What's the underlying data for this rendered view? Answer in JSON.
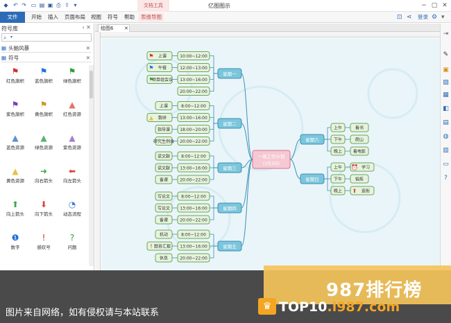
{
  "app": {
    "title": "亿图图示",
    "context_tab": "文档工具"
  },
  "menu": {
    "file": "文件",
    "items": [
      "开始",
      "插入",
      "页面布局",
      "视图",
      "符号",
      "帮助",
      "思维导图"
    ],
    "login": "登录"
  },
  "sidebar": {
    "title": "符号库",
    "sections": [
      "头脑风暴",
      "符号"
    ],
    "symbols": [
      {
        "label": "红色旗帜",
        "glyph": "⚑",
        "color": "#d32f2f"
      },
      {
        "label": "蓝色旗帜",
        "glyph": "⚑",
        "color": "#1e6fd9"
      },
      {
        "label": "绿色旗帜",
        "glyph": "⚑",
        "color": "#2e9e3a"
      },
      {
        "label": "紫色旗帜",
        "glyph": "⚑",
        "color": "#7b3fb5"
      },
      {
        "label": "黄色旗帜",
        "glyph": "⚑",
        "color": "#c99a1e"
      },
      {
        "label": "红色资源",
        "glyph": "▲",
        "color": "#e5736b"
      },
      {
        "label": "蓝色资源",
        "glyph": "▲",
        "color": "#5b8fd6"
      },
      {
        "label": "绿色资源",
        "glyph": "▲",
        "color": "#58b368"
      },
      {
        "label": "紫色资源",
        "glyph": "▲",
        "color": "#a67cd1"
      },
      {
        "label": "黄色资源",
        "glyph": "▲",
        "color": "#e7c34a"
      },
      {
        "label": "向右箭头",
        "glyph": "➜",
        "color": "#3aa845"
      },
      {
        "label": "向左箭头",
        "glyph": "⬅",
        "color": "#d9453b"
      },
      {
        "label": "向上箭头",
        "glyph": "⬆",
        "color": "#3aa845"
      },
      {
        "label": "向下箭头",
        "glyph": "⬇",
        "color": "#d9453b"
      },
      {
        "label": "动态流程",
        "glyph": "◔",
        "color": "#3b7dd8"
      },
      {
        "label": "数字",
        "glyph": "❶",
        "color": "#1e6fd9"
      },
      {
        "label": "感叹号",
        "glyph": "!",
        "color": "#d32f2f"
      },
      {
        "label": "问题",
        "glyph": "?",
        "color": "#2e9e3a"
      }
    ]
  },
  "doc_tab": "绘图6",
  "mindmap": {
    "center": {
      "line1": "一周工作计划",
      "line2": "(3月3日)"
    },
    "days": [
      {
        "name": "星期一",
        "items": [
          {
            "text": "上课",
            "icon": "⚑",
            "icon_color": "#d32f2f",
            "time": "10:00~12:00"
          },
          {
            "text": "午餐",
            "icon": "⚑",
            "icon_color": "#1e6fd9",
            "time": "12:00~13:00"
          },
          {
            "text": "项目组会议",
            "icon": "⚑",
            "icon_color": "#2e9e3a",
            "time": "13:00~16:00"
          },
          {
            "text": "",
            "icon": "",
            "icon_color": "",
            "time": "20:00~22:00"
          }
        ]
      },
      {
        "name": "星期二",
        "items": [
          {
            "text": "上课",
            "icon": "",
            "icon_color": "",
            "time": "8:00~12:00"
          },
          {
            "text": "数研",
            "icon": "▲",
            "icon_color": "#e7c34a",
            "time": "13:00~16:00"
          },
          {
            "text": "指导课",
            "icon": "",
            "icon_color": "",
            "time": "18:00~20:00"
          },
          {
            "text": "研究生例会",
            "icon": "",
            "icon_color": "",
            "time": "20:00~22:00"
          }
        ]
      },
      {
        "name": "星期三",
        "items": [
          {
            "text": "读文献",
            "icon": "",
            "icon_color": "",
            "time": "8:00~12:00"
          },
          {
            "text": "读文献",
            "icon": "",
            "icon_color": "",
            "time": "13:00~16:00"
          },
          {
            "text": "备课",
            "icon": "",
            "icon_color": "",
            "time": "20:00~22:00"
          }
        ]
      },
      {
        "name": "星期四",
        "items": [
          {
            "text": "写论文",
            "icon": "",
            "icon_color": "",
            "time": "8:00~12:00"
          },
          {
            "text": "写论文",
            "icon": "",
            "icon_color": "",
            "time": "13:00~16:00"
          },
          {
            "text": "备课",
            "icon": "",
            "icon_color": "",
            "time": "20:00~22:00"
          }
        ]
      },
      {
        "name": "星期五",
        "items": [
          {
            "text": "机动",
            "icon": "",
            "icon_color": "",
            "time": "8:00~12:00"
          },
          {
            "text": "题目汇报",
            "icon": "!",
            "icon_color": "#d32f2f",
            "time": "13:00~16:00"
          },
          {
            "text": "休息",
            "icon": "",
            "icon_color": "",
            "time": "20:00~22:00"
          }
        ]
      },
      {
        "name": "星期六",
        "items": [
          {
            "text": "上午",
            "icon": "",
            "icon_color": "",
            "time": "看书"
          },
          {
            "text": "下午",
            "icon": "",
            "icon_color": "",
            "time": "爬山"
          },
          {
            "text": "晚上",
            "icon": "",
            "icon_color": "",
            "time": "看电影"
          }
        ]
      },
      {
        "name": "星期日",
        "items": [
          {
            "text": "上午",
            "icon": "⏰",
            "icon_color": "#d32f2f",
            "time": "学习"
          },
          {
            "text": "下午",
            "icon": "",
            "icon_color": "",
            "time": "锻炼"
          },
          {
            "text": "晚上",
            "icon": "⬆",
            "icon_color": "#d9453b",
            "time": "逛街"
          }
        ]
      }
    ]
  },
  "watermark": {
    "brand": "987排行榜",
    "caption": "图片来自网络，如有侵权请与本站联系",
    "site_a": "TOP10",
    "site_b": ".i987.com"
  }
}
